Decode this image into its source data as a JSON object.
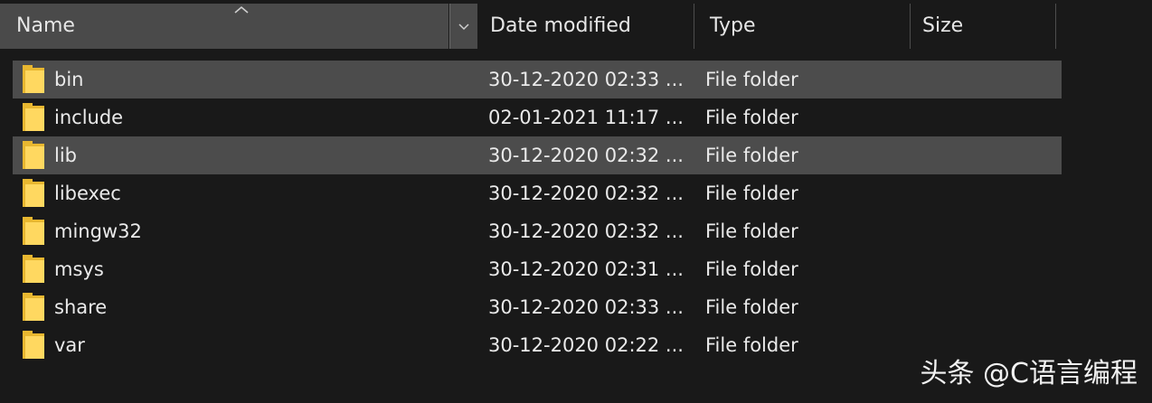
{
  "columns": {
    "name": "Name",
    "date": "Date modified",
    "type": "Type",
    "size": "Size"
  },
  "rows": [
    {
      "name": "bin",
      "date": "30-12-2020 02:33 ...",
      "type": "File folder",
      "size": "",
      "selected": true
    },
    {
      "name": "include",
      "date": "02-01-2021 11:17 ...",
      "type": "File folder",
      "size": "",
      "selected": false
    },
    {
      "name": "lib",
      "date": "30-12-2020 02:32 ...",
      "type": "File folder",
      "size": "",
      "selected": true
    },
    {
      "name": "libexec",
      "date": "30-12-2020 02:32 ...",
      "type": "File folder",
      "size": "",
      "selected": false
    },
    {
      "name": "mingw32",
      "date": "30-12-2020 02:32 ...",
      "type": "File folder",
      "size": "",
      "selected": false
    },
    {
      "name": "msys",
      "date": "30-12-2020 02:31 ...",
      "type": "File folder",
      "size": "",
      "selected": false
    },
    {
      "name": "share",
      "date": "30-12-2020 02:33 ...",
      "type": "File folder",
      "size": "",
      "selected": false
    },
    {
      "name": "var",
      "date": "30-12-2020 02:22 ...",
      "type": "File folder",
      "size": "",
      "selected": false
    }
  ],
  "icons": {
    "folder": "folder-icon",
    "sort": "sort-ascending-icon",
    "dropdown": "chevron-down-icon"
  },
  "colors": {
    "background": "#191919",
    "header_active": "#4a4a4a",
    "selected_row": "#4c4c4c",
    "folder": "#f5c542"
  },
  "watermark": "头条 @C语言编程"
}
